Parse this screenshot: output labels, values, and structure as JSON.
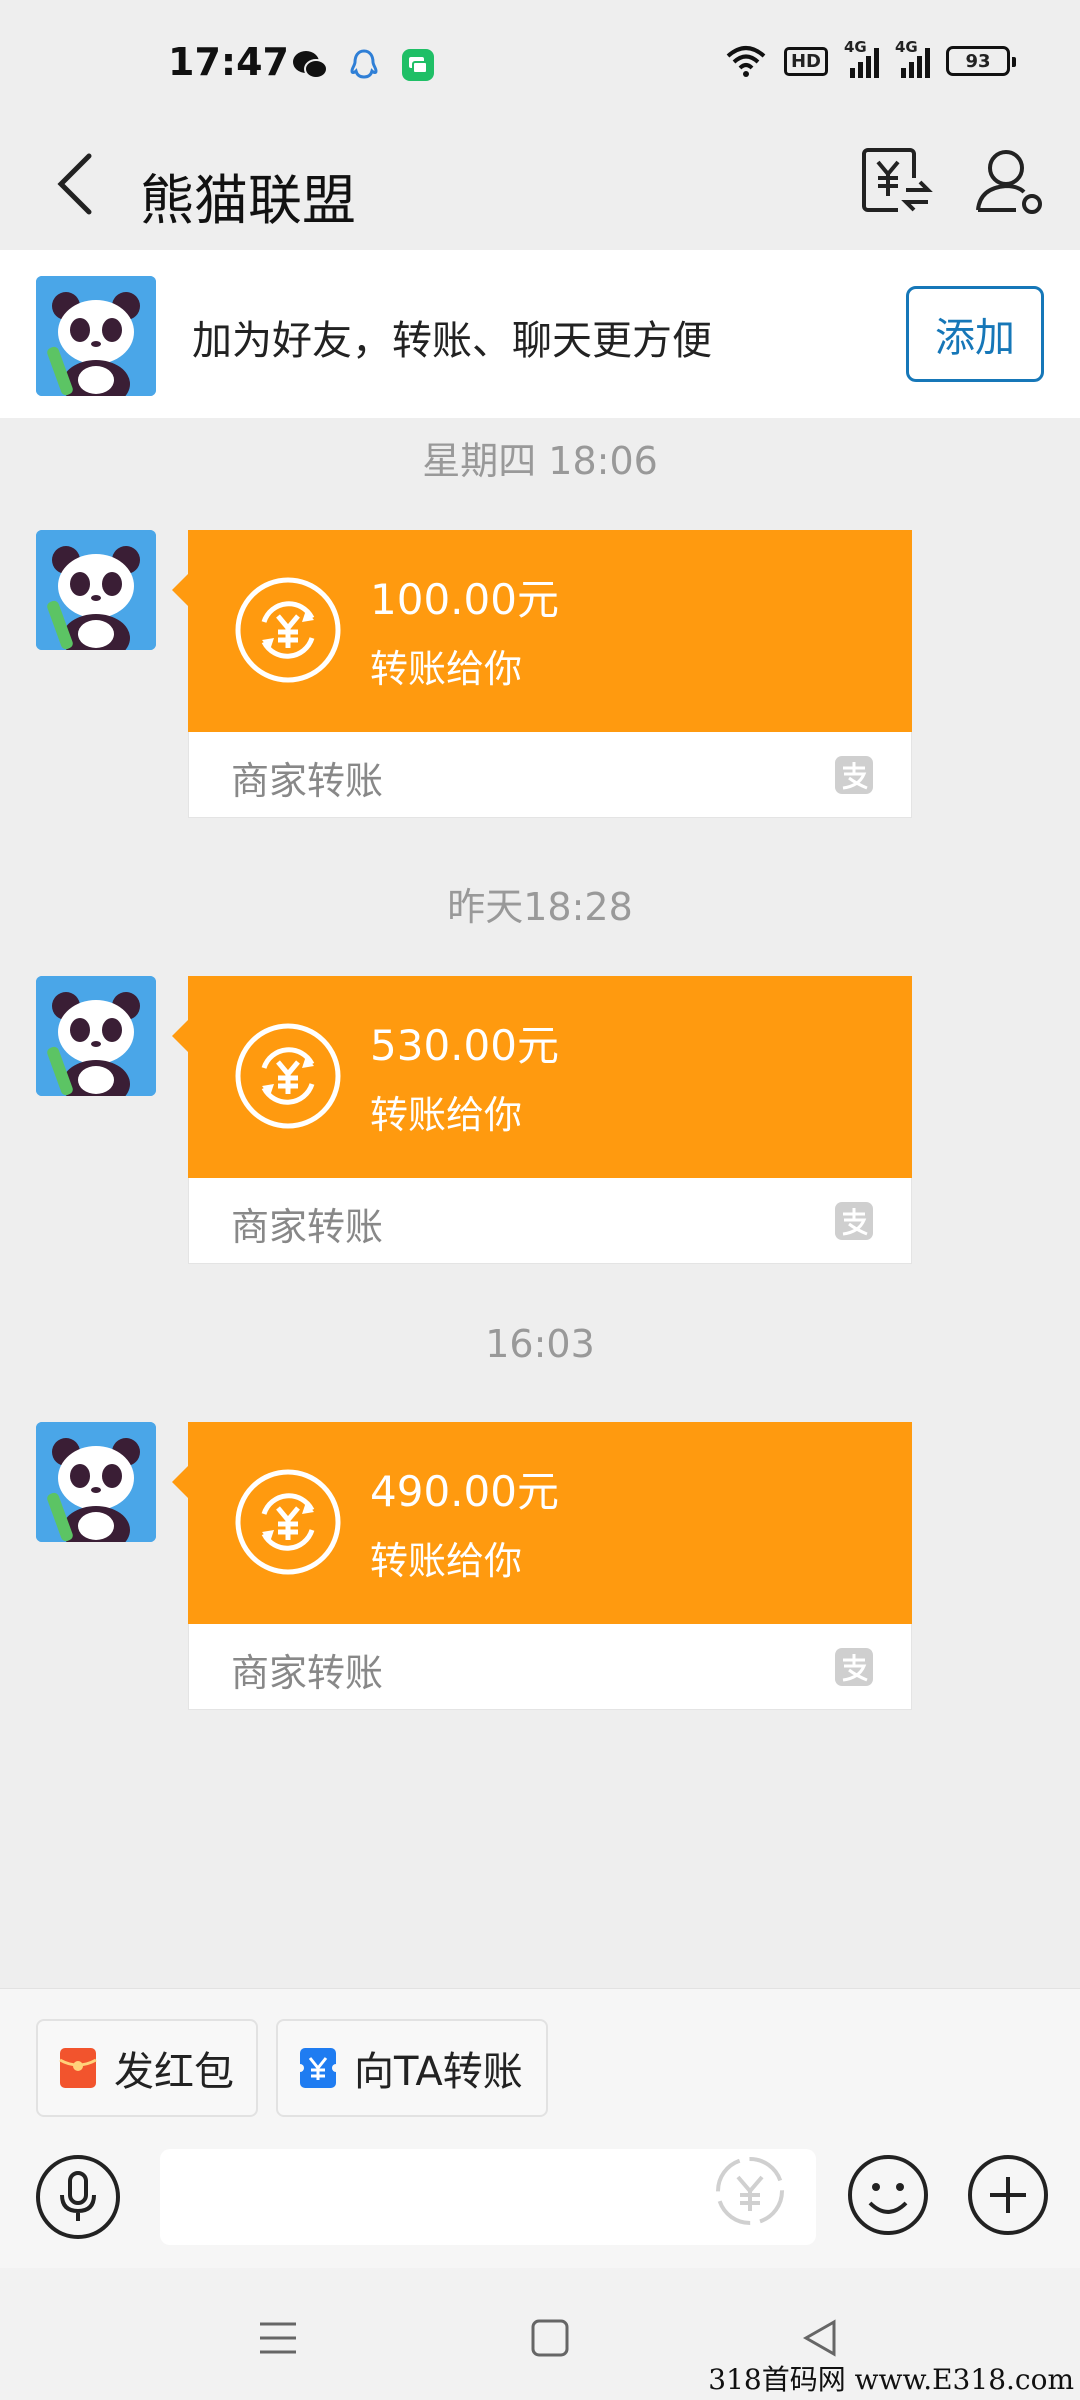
{
  "status_bar": {
    "time": "17:47",
    "hd": "HD",
    "net1": "4G",
    "net2": "4G",
    "battery": "93"
  },
  "nav": {
    "title": "熊猫联盟"
  },
  "banner": {
    "text": "加为好友，转账、聊天更方便",
    "add_label": "添加"
  },
  "messages": [
    {
      "time": "星期四 18:06",
      "amount": "100.00元",
      "desc": "转账给你",
      "source": "商家转账"
    },
    {
      "time": "昨天18:28",
      "amount": "530.00元",
      "desc": "转账给你",
      "source": "商家转账"
    },
    {
      "time": "16:03",
      "amount": "490.00元",
      "desc": "转账给你",
      "source": "商家转账"
    }
  ],
  "bottom": {
    "red_packet_label": "发红包",
    "transfer_label": "向TA转账",
    "input_placeholder": ""
  },
  "watermark": "318首码网 www.E318.com",
  "colors": {
    "card_orange": "#ff9a0f",
    "accent_blue": "#1677b8",
    "red_packet": "#f2542d",
    "transfer_blue": "#1f7cf1"
  }
}
